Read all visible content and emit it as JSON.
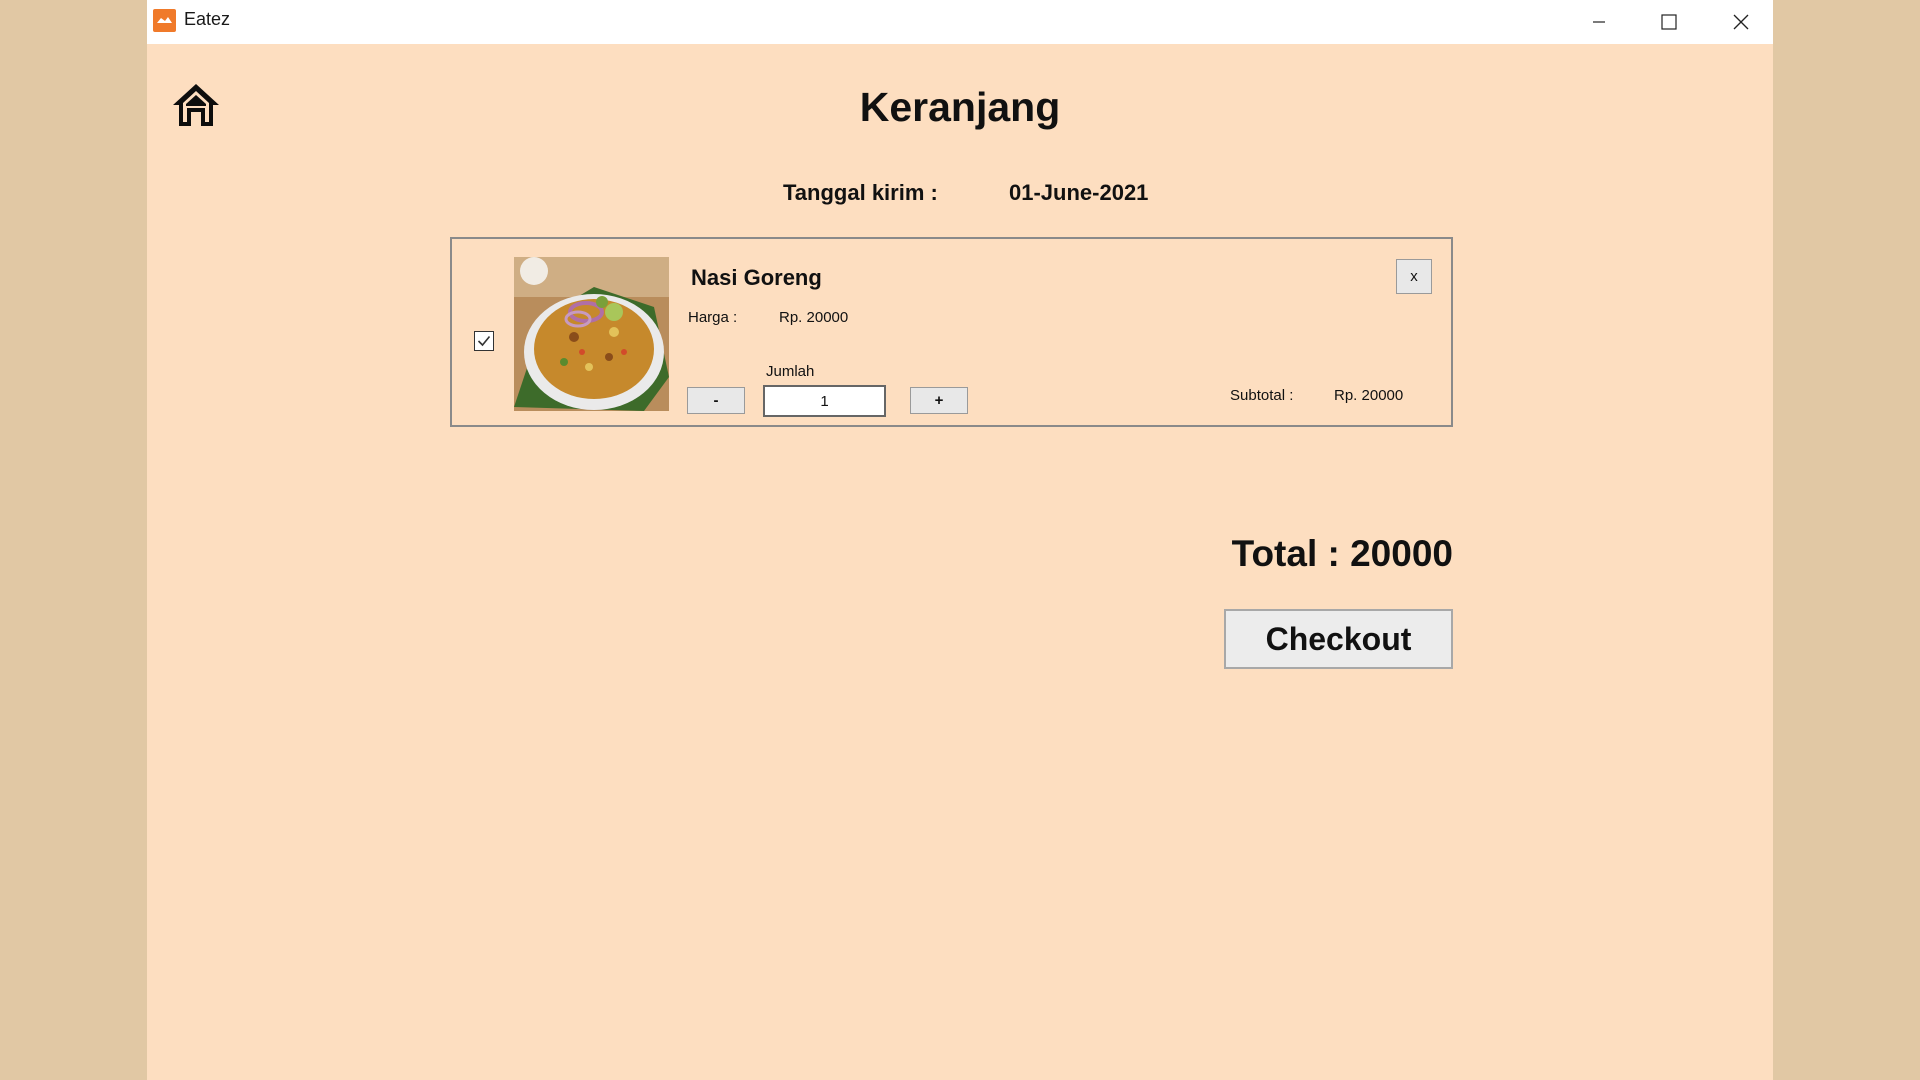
{
  "window": {
    "app_title": "Eatez",
    "app_icon": "eatez-logo-icon",
    "controls": [
      "minimize-icon",
      "maximize-icon",
      "close-icon"
    ]
  },
  "nav": {
    "home_icon": "home-icon"
  },
  "page": {
    "title": "Keranjang",
    "date_label": "Tanggal kirim :",
    "date_value": "01-June-2021"
  },
  "cart": {
    "items": [
      {
        "selected": true,
        "name": "Nasi Goreng",
        "price_label": "Harga :",
        "price_value": "Rp. 20000",
        "qty_label": "Jumlah",
        "minus_label": "-",
        "qty_value": "1",
        "plus_label": "+",
        "remove_label": "x",
        "subtotal_label": "Subtotal :",
        "subtotal_value": "Rp. 20000"
      }
    ]
  },
  "summary": {
    "total_text": "Total : 20000",
    "checkout_label": "Checkout"
  },
  "colors": {
    "background": "#fddec0",
    "desktop": "#e1c8a4",
    "accent": "#f07a2a"
  }
}
